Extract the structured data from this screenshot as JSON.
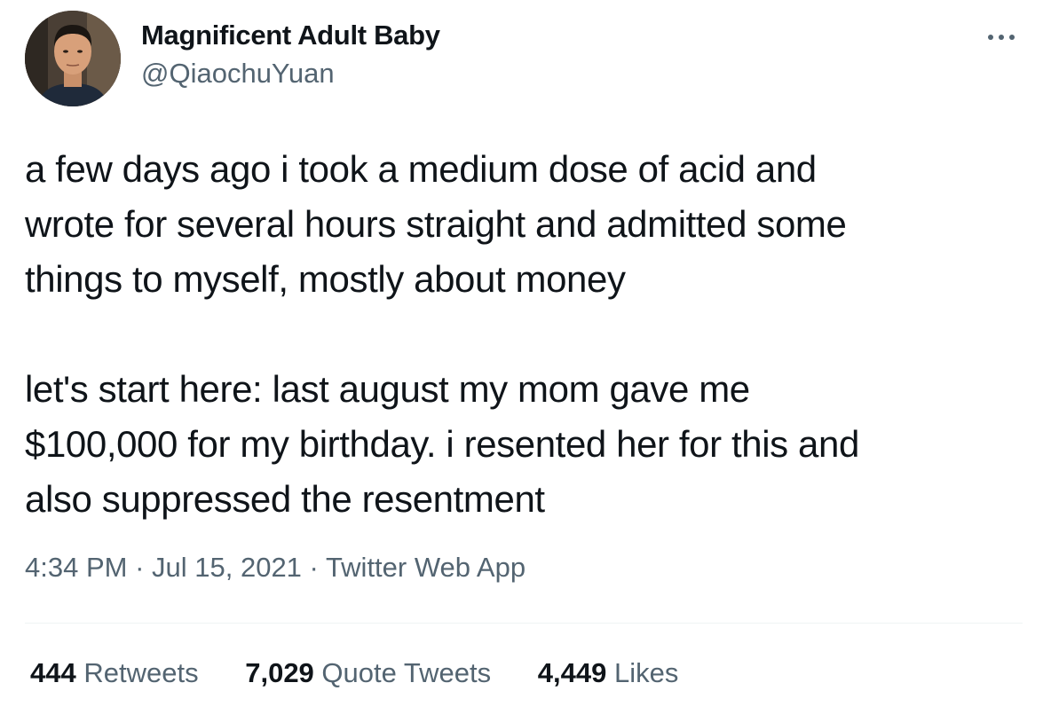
{
  "author": {
    "display_name": "Magnificent Adult Baby",
    "handle": "@QiaochuYuan"
  },
  "tweet": {
    "paragraphs": [
      "a few days ago i took a medium dose of acid and\nwrote for several hours straight and admitted some\nthings to myself, mostly about money",
      "let's start here: last august my mom gave me\n$100,000 for my birthday. i resented her for this and\nalso suppressed the resentment"
    ],
    "time": "4:34 PM",
    "date": "Jul 15, 2021",
    "source": "Twitter Web App",
    "separator": " · "
  },
  "stats": {
    "retweets": {
      "count": "444",
      "label": "Retweets"
    },
    "quote_tweets": {
      "count": "7,029",
      "label": "Quote Tweets"
    },
    "likes": {
      "count": "4,449",
      "label": "Likes"
    }
  },
  "icons": {
    "more": "more-horizontal-icon"
  },
  "colors": {
    "text": "#0f1419",
    "secondary": "#536471",
    "divider": "#eff3f4"
  }
}
